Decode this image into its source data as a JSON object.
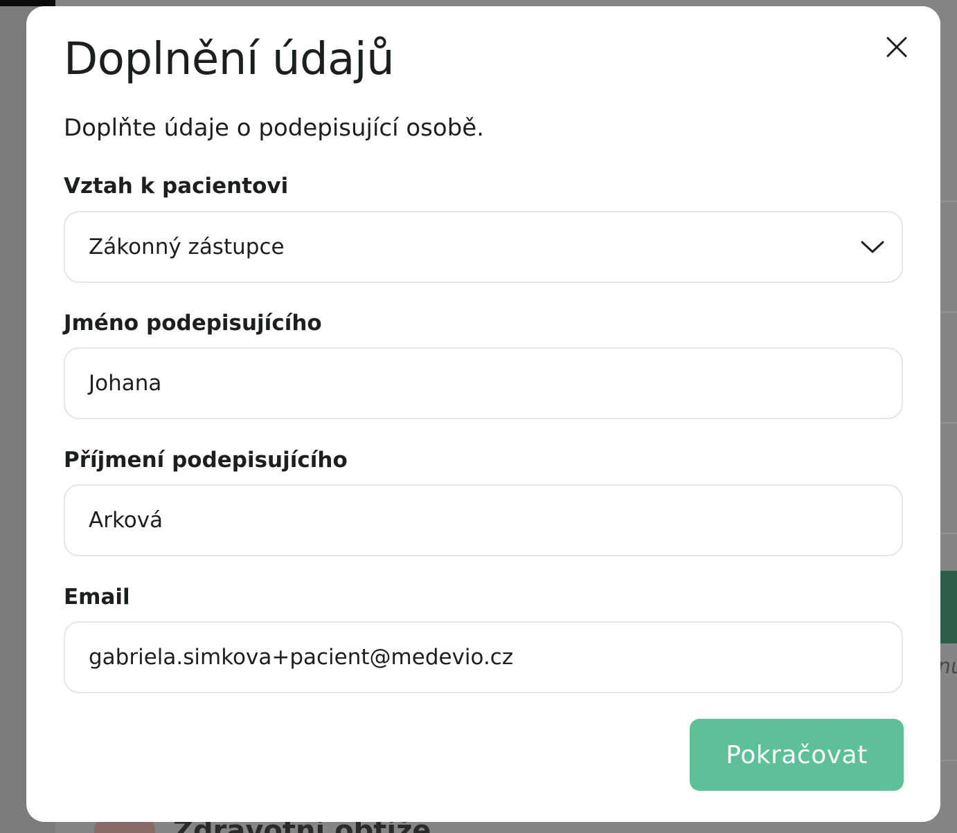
{
  "background": {
    "partial_text": "nu",
    "partial_heading": "Zdravotní obtíže"
  },
  "modal": {
    "title": "Doplnění údajů",
    "subtitle": "Doplňte údaje o podepisující osobě.",
    "close_icon": "close-icon",
    "fields": {
      "relationship": {
        "label": "Vztah k pacientovi",
        "value": "Zákonný zástupce",
        "icon": "chevron-down-icon"
      },
      "first_name": {
        "label": "Jméno podepisujícího",
        "value": "Johana"
      },
      "last_name": {
        "label": "Příjmení podepisujícího",
        "value": "Arková"
      },
      "email": {
        "label": "Email",
        "value": "gabriela.simkova+pacient@medevio.cz"
      }
    },
    "continue_label": "Pokračovat"
  },
  "colors": {
    "primary_button": "#5ec098",
    "text": "#1b1f1e",
    "field_border": "#e4e6e5",
    "backdrop": "#7c7c7c"
  }
}
